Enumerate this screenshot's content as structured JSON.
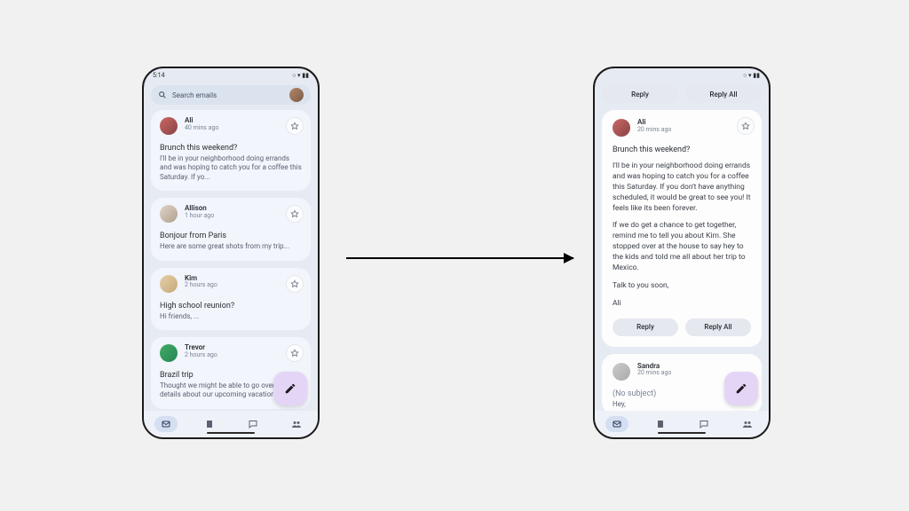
{
  "status": {
    "time": "5:14",
    "icons": "○ ▾ ▮▮"
  },
  "search": {
    "placeholder": "Search emails"
  },
  "inbox": [
    {
      "sender": "Ali",
      "time": "40 mins ago",
      "subject": "Brunch this weekend?",
      "preview": "I'll be in your neighborhood doing errands and was hoping to catch you for a coffee this Saturday. If yo..."
    },
    {
      "sender": "Allison",
      "time": "1 hour ago",
      "subject": "Bonjour from Paris",
      "preview": "Here are some great shots from my trip..."
    },
    {
      "sender": "Kim",
      "time": "2 hours ago",
      "subject": "High school reunion?",
      "preview": "Hi friends,\n..."
    },
    {
      "sender": "Trevor",
      "time": "2 hours ago",
      "subject": "Brazil trip",
      "preview": "Thought we might be able to go over some details about our upcoming vacation..."
    }
  ],
  "detail_top_buttons": {
    "reply": "Reply",
    "reply_all": "Reply All"
  },
  "detail": {
    "sender": "Ali",
    "time": "20 mins ago",
    "subject": "Brunch this weekend?",
    "p1": "I'll be in your neighborhood doing errands and was hoping to catch you for a coffee this Saturday. If you don't have anything scheduled, it would be great to see you! It feels like its been forever.",
    "p2": "If we do get a chance to get together, remind me to tell you about Kim. She stopped over at the house to say hey to the kids and told me all about her trip to Mexico.",
    "p3": "Talk to you soon,",
    "p4": "Ali"
  },
  "detail_buttons": {
    "reply": "Reply",
    "reply_all": "Reply All"
  },
  "second": {
    "sender": "Sandra",
    "time": "20 mins ago",
    "subject": "(No subject)",
    "preview": "Hey,"
  }
}
